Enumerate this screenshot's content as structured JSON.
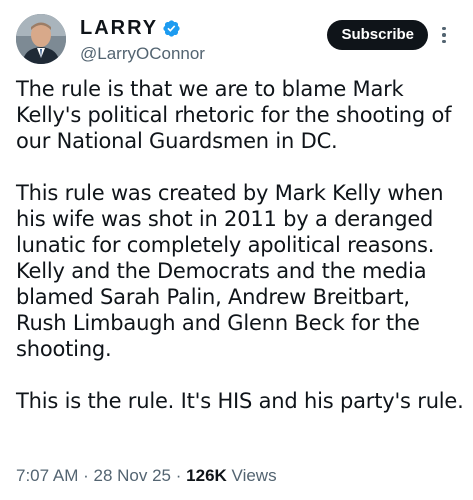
{
  "author": {
    "display_name": "LARRY",
    "handle": "@LarryOConnor",
    "verified": true,
    "verified_color": "#1d9bf0"
  },
  "actions": {
    "subscribe_label": "Subscribe",
    "more_icon": "more-vertical-icon"
  },
  "tweet": {
    "paragraphs": [
      "The rule is that we are to blame Mark Kelly's political rhetoric for the shooting of our National Guardsmen in DC.",
      "This rule was created by Mark Kelly when his wife was shot in 2011 by a deranged lunatic for completely apolitical reasons. Kelly and the Democrats and the media blamed Sarah Palin, Andrew Breitbart, Rush Limbaugh and Glenn Beck for the shooting.",
      "This is the rule. It's HIS and his party's rule."
    ]
  },
  "meta": {
    "time": "7:07 AM",
    "date": "28 Nov 25",
    "separator": "·",
    "views_count": "126K",
    "views_label": "Views"
  },
  "colors": {
    "text": "#0f1419",
    "secondary": "#536471",
    "button_bg": "#0f1419",
    "button_text": "#ffffff"
  }
}
